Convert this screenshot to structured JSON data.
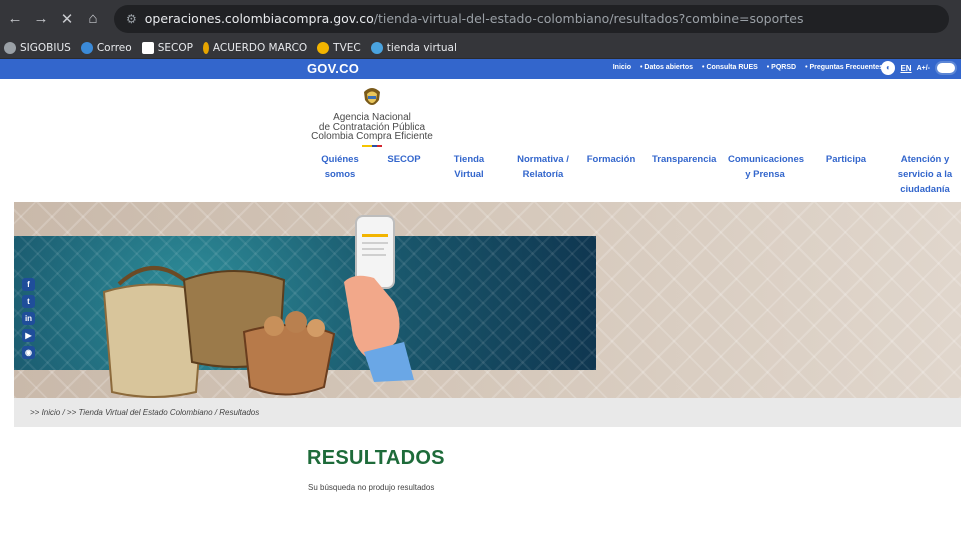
{
  "browser": {
    "url_host": "operaciones.colombiacompra.gov.co",
    "url_path": "/tienda-virtual-del-estado-colombiano/resultados?combine=soportes",
    "nav_icons": [
      "back-icon",
      "forward-icon",
      "close-icon",
      "home-icon"
    ]
  },
  "bookmarks": [
    {
      "label": "SIGOBIUS",
      "color": "#9aa0a6"
    },
    {
      "label": "Correo",
      "color": "#3b8ad8"
    },
    {
      "label": "SECOP",
      "color": "#ffffff"
    },
    {
      "label": "ACUERDO MARCO",
      "color": "#e6a400"
    },
    {
      "label": "TVEC",
      "color": "#f2b400"
    },
    {
      "label": "tienda virtual",
      "color": "#4aa3df"
    }
  ],
  "govbar": {
    "logo": "GOV.CO",
    "links": [
      "Inicio",
      "• Datos abiertos",
      "• Consulta RUES",
      "• PQRSD",
      "• Preguntas Frecuentes"
    ],
    "lang": "EN",
    "text_size": "A+/-",
    "color": "#3366cc"
  },
  "header": {
    "agency_line1": "Agencia Nacional",
    "agency_line2": "de Contratación Pública",
    "agency_line3": "Colombia Compra Eficiente"
  },
  "mainnav": {
    "items": [
      {
        "l1": "Quiénes somos",
        "l2": "",
        "l3": ""
      },
      {
        "l1": "SECOP",
        "l2": "",
        "l3": ""
      },
      {
        "l1": "Tienda Virtual",
        "l2": "",
        "l3": ""
      },
      {
        "l1": "Normativa /",
        "l2": "Relatoría",
        "l3": ""
      },
      {
        "l1": "Formación",
        "l2": "",
        "l3": ""
      },
      {
        "l1": "Transparencia",
        "l2": "",
        "l3": ""
      },
      {
        "l1": "Comunicaciones",
        "l2": "y Prensa",
        "l3": ""
      },
      {
        "l1": "Participa",
        "l2": "",
        "l3": ""
      },
      {
        "l1": "Atención y",
        "l2": "servicio a la",
        "l3": "ciudadanía"
      }
    ]
  },
  "social": [
    {
      "icon": "facebook-icon",
      "glyph": "f"
    },
    {
      "icon": "twitter-icon",
      "glyph": "t"
    },
    {
      "icon": "linkedin-icon",
      "glyph": "in"
    },
    {
      "icon": "youtube-icon",
      "glyph": "▶"
    },
    {
      "icon": "rss-icon",
      "glyph": "◉"
    }
  ],
  "breadcrumb": ">> Inicio / >> Tienda Virtual del Estado Colombiano / Resultados",
  "results": {
    "title": "RESULTADOS",
    "message": "Su búsqueda no produjo resultados"
  },
  "colors": {
    "title_green": "#1e6b3a",
    "nav_blue": "#3366cc"
  }
}
